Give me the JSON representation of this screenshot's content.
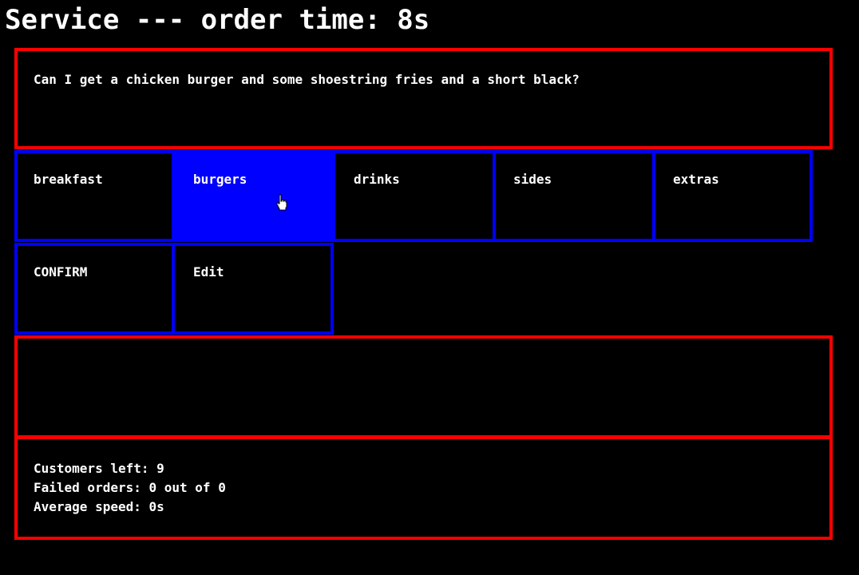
{
  "header": {
    "title": "Service --- order time: 8s"
  },
  "customer": {
    "request": "Can I get a chicken burger and some shoestring fries and a short black?"
  },
  "menu": {
    "categories": [
      {
        "label": "breakfast",
        "active": false
      },
      {
        "label": "burgers",
        "active": true
      },
      {
        "label": "drinks",
        "active": false
      },
      {
        "label": "sides",
        "active": false
      },
      {
        "label": "extras",
        "active": false
      }
    ],
    "actions": [
      {
        "label": "CONFIRM"
      },
      {
        "label": "Edit"
      }
    ]
  },
  "order": {
    "items": []
  },
  "stats": {
    "customers_left": "Customers left: 9",
    "failed_orders": "Failed orders: 0 out of 0",
    "average_speed": "Average speed: 0s"
  },
  "colors": {
    "panel_border": "#ff0000",
    "tile_border": "#0000ff",
    "active_tile": "#0000ff"
  }
}
